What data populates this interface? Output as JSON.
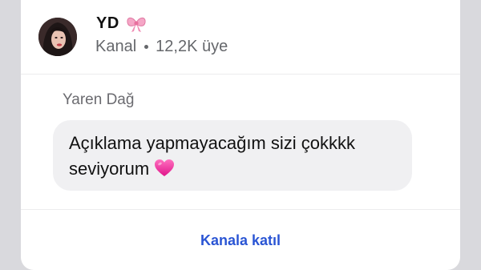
{
  "channel": {
    "name": "YD",
    "name_emoji": "ribbon-bow-icon",
    "type_label": "Kanal",
    "member_count": "12,2K üye"
  },
  "message": {
    "sender": "Yaren Dağ",
    "text": "Açıklama yapmayacağım sizi çokkkk seviyorum",
    "emoji": "pink-heart-icon"
  },
  "footer": {
    "join_label": "Kanala katıl"
  },
  "colors": {
    "accent": "#2a55d4",
    "bubble": "#f0f0f2",
    "heart": "#f23a9c",
    "bow": "#f5a6c6"
  }
}
